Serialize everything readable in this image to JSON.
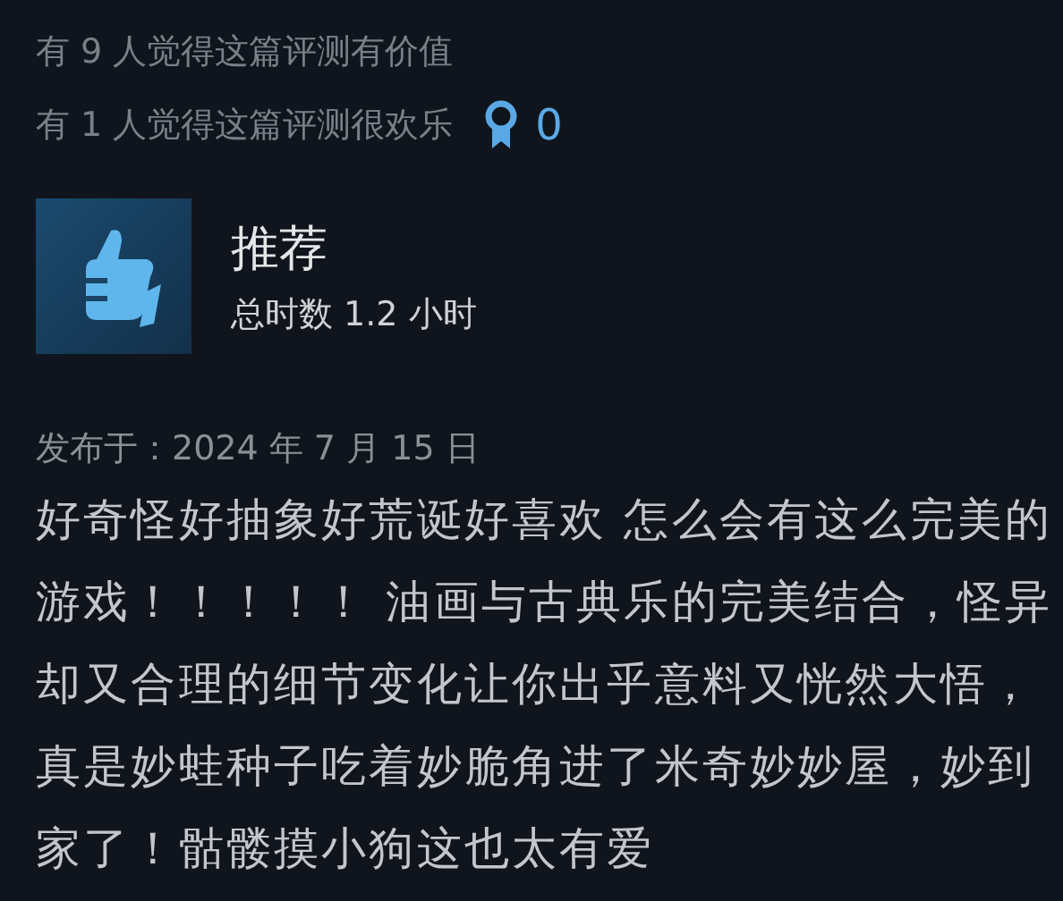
{
  "helpful_lines": [
    "有 9 人觉得这篇评测有价值",
    "有 1 人觉得这篇评测很欢乐"
  ],
  "award_count": "0",
  "review": {
    "verdict": "推荐",
    "playtime": "总时数 1.2 小时",
    "posted": "发布于：2024 年 7 月 15 日",
    "body": "好奇怪好抽象好荒诞好喜欢 怎么会有这么完美的游戏！！！！！ 油画与古典乐的完美结合，怪异却又合理的细节变化让你出乎意料又恍然大悟，真是妙蛙种子吃着妙脆角进了米奇妙妙屋，妙到家了！骷髅摸小狗这也太有爱"
  }
}
